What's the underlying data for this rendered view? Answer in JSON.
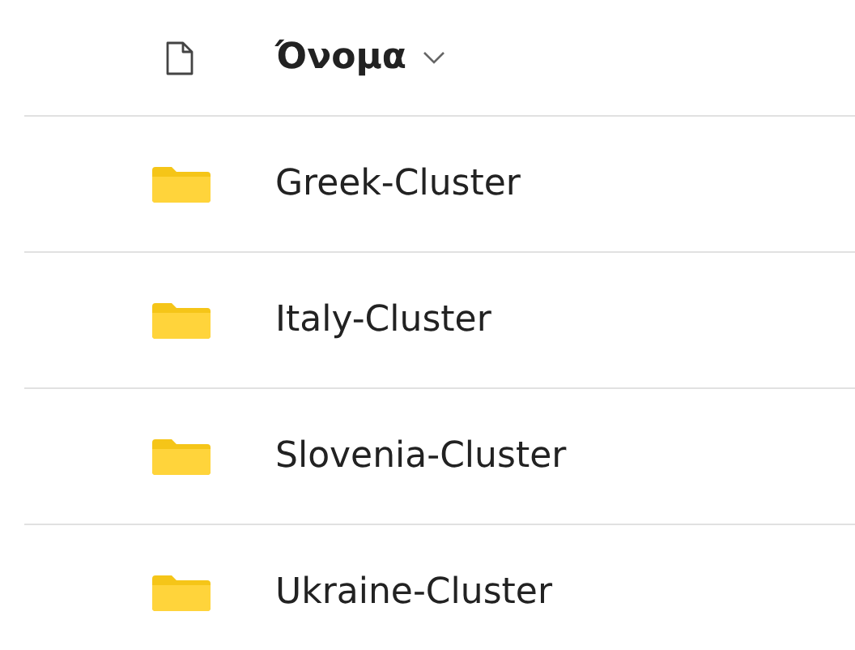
{
  "header": {
    "name_column": "Όνομα"
  },
  "rows": [
    {
      "name": "Greek-Cluster",
      "kind": "folder"
    },
    {
      "name": "Italy-Cluster",
      "kind": "folder"
    },
    {
      "name": "Slovenia-Cluster",
      "kind": "folder"
    },
    {
      "name": "Ukraine-Cluster",
      "kind": "folder"
    }
  ]
}
